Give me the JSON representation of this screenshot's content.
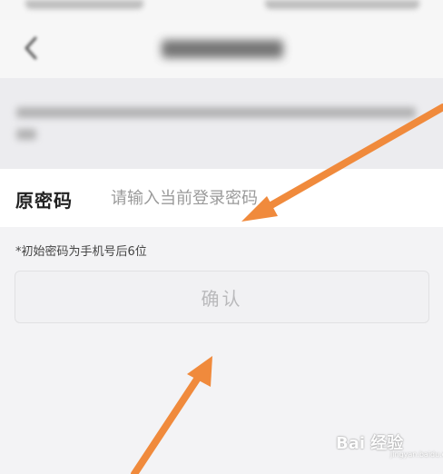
{
  "password_row": {
    "label": "原密码",
    "placeholder": "请输入当前登录密码"
  },
  "hint": "*初始密码为手机号后6位",
  "confirm_label": "确认",
  "watermark": {
    "text": "Bai 经验",
    "sub": "jingyan.baidu.com"
  },
  "colors": {
    "annotation_arrow": "#f08a3c",
    "page_background": "#f3f3f5",
    "row_background": "#ffffff",
    "button_text": "#b9b9bb"
  }
}
